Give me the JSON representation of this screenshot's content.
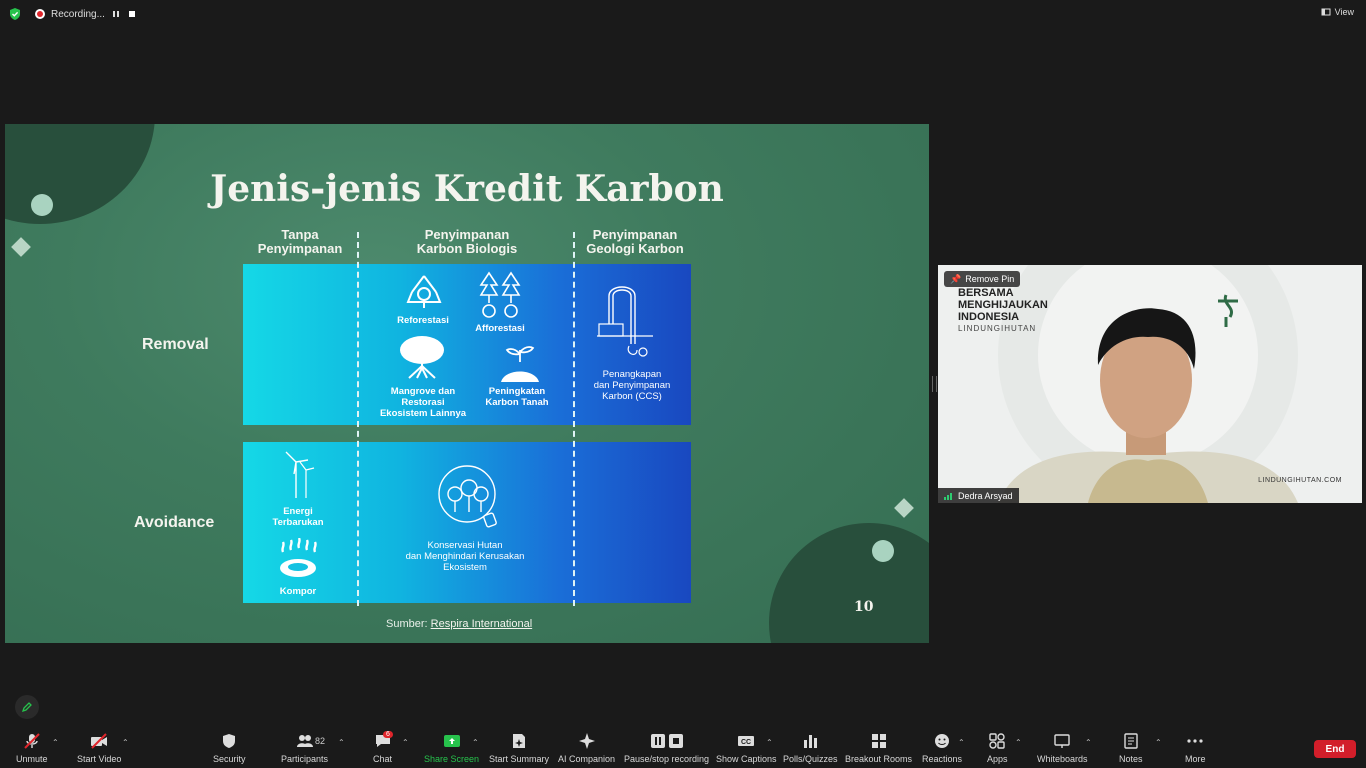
{
  "topbar": {
    "recording_label": "Recording...",
    "view_label": "View"
  },
  "slide": {
    "title": "Jenis-jenis Kredit Karbon",
    "columns": [
      {
        "line1": "Tanpa",
        "line2": "Penyimpanan"
      },
      {
        "line1": "Penyimpanan",
        "line2": "Karbon Biologis"
      },
      {
        "line1": "Penyimpanan",
        "line2": "Geologi Karbon"
      }
    ],
    "rows": [
      "Removal",
      "Avoidance"
    ],
    "removal_items": {
      "reforestasi": "Reforestasi",
      "afforestasi": "Afforestasi",
      "mangrove_1": "Mangrove dan",
      "mangrove_2": "Restorasi",
      "mangrove_3": "Ekosistem Lainnya",
      "tanah_1": "Peningkatan",
      "tanah_2": "Karbon Tanah",
      "ccs_1": "Penangkapan",
      "ccs_2": "dan Penyimpanan",
      "ccs_3": "Karbon (CCS)"
    },
    "avoidance_items": {
      "energi_1": "Energi",
      "energi_2": "Terbarukan",
      "kompor": "Kompor",
      "hutan_1": "Konservasi Hutan",
      "hutan_2": "dan Menghindari Kerusakan",
      "hutan_3": "Ekosistem"
    },
    "source_prefix": "Sumber:",
    "source_link": "Respira International",
    "page_number": "10"
  },
  "video": {
    "pin_label": "Remove Pin",
    "participant_name": "Dedra Arsyad",
    "brand_line1": "BERSAMA",
    "brand_line2": "MENGHIJAUKAN",
    "brand_line3": "INDONESIA",
    "brand_line4": "LINDUNGIHUTAN",
    "url": "LINDUNGIHUTAN.COM"
  },
  "toolbar": {
    "unmute": "Unmute",
    "start_video": "Start Video",
    "security": "Security",
    "participants": "Participants",
    "participants_count": "82",
    "chat": "Chat",
    "chat_badge": "6",
    "share_screen": "Share Screen",
    "start_summary": "Start Summary",
    "ai_companion": "AI Companion",
    "pause_recording": "Pause/stop recording",
    "show_captions": "Show Captions",
    "polls": "Polls/Quizzes",
    "breakout": "Breakout Rooms",
    "reactions": "Reactions",
    "apps": "Apps",
    "whiteboards": "Whiteboards",
    "notes": "Notes",
    "more": "More",
    "end": "End"
  },
  "colors": {
    "share_green": "#27c24c",
    "end_red": "#d21e2a",
    "slide_green": "#3f7b5e"
  }
}
